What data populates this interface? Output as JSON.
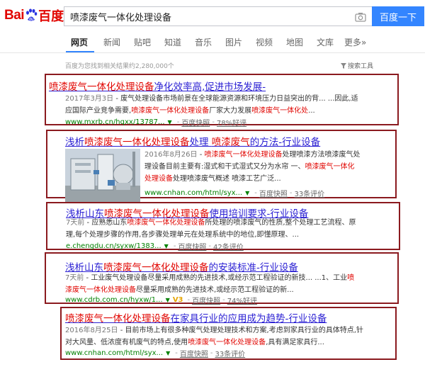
{
  "logo": {
    "bai": "Bai",
    "du": "百度"
  },
  "search": {
    "query": "喷漆废气一体化处理设备",
    "button": "百度一下"
  },
  "nav": {
    "tabs": [
      "网页",
      "新闻",
      "贴吧",
      "知道",
      "音乐",
      "图片",
      "视频",
      "地图",
      "文库",
      "更多»"
    ]
  },
  "result_stats": "百度为您找到相关结果约2,280,000个",
  "search_tools": "搜索工具",
  "results": [
    {
      "title_parts": [
        "喷漆废气一体化处理设备",
        "净化效率高,促进市场发展-"
      ],
      "abstract": {
        "line1": [
          "2017年3月3日",
          " - 废气处理设备市场前景在全球能源资源和环境压力日益突出的背... ...因此,适"
        ],
        "line2": [
          "应国际产业竞争需要,",
          "喷漆废气一体化处理设备",
          "厂家大力发展",
          "喷漆废气一体化处",
          "..."
        ]
      },
      "url": "www.mxrb.cn/hqxx/13787...",
      "cache": "百度快照",
      "rating": "78%好评"
    },
    {
      "title_parts": [
        "浅析",
        "喷漆废气一体化处理设备",
        "处理 ",
        "喷漆废气",
        "的方法-行业设备"
      ],
      "abstract": {
        "line1": [
          "2016年8月26日",
          " - ",
          "喷漆废气一体化处理设备",
          "处理喷漆方法喷漆废气处"
        ],
        "line2": [
          "理设备目前主要有:湿式和干式湿式又分为水帘 一、",
          "喷漆废气一体化"
        ],
        "line3": [
          "处理设备",
          "处理喷漆废气概述 喷漆工艺广泛..."
        ]
      },
      "url": "www.cnhan.com/html/syx...",
      "cache": "百度快照",
      "rating": "33条评价"
    },
    {
      "title_parts": [
        "浅析山东",
        "喷漆废气一体化处理设备",
        "使用培训要求-行业设备"
      ],
      "abstract": {
        "line1": [
          "7天前",
          " - 应熟悉山东",
          "喷漆废气一体化处理设备",
          "所处理的喷漆废气的性质,整个处理工艺流程、原"
        ],
        "line2": [
          "理,每个处理步骤的作用,各步骤处理单元在处理系统中的地位,即懂原理、..."
        ]
      },
      "url": "e.chengdu.cn/syxw/1383...",
      "cache": "百度快照",
      "rating": "42条评价"
    },
    {
      "title_parts": [
        "浅析山东",
        "喷漆废气一体化处理设备",
        "的安装标准-行业设备"
      ],
      "abstract": {
        "line1": [
          "7天前",
          " - 工业废气处理设备尽量采用成熟的先进技术,或经示范工程验证的新技... ...1、工业",
          "喷"
        ],
        "line2": [
          "漆废气一体化处理设备",
          "尽量采用成熟的先进技术,或经示范工程验证的新..."
        ]
      },
      "url": "www.cdrb.com.cn/hyxw/1...",
      "v3": "V3",
      "cache": "百度快照",
      "rating": "74%好评"
    },
    {
      "title_parts": [
        "喷漆废气一体化处理设备",
        "在家具行业的应用成为趋势-行业设备"
      ],
      "abstract": {
        "line1": [
          "2016年8月25日",
          " - 目前市场上有很多种废气处理处理技术和方案,考虑到家具行业的具体特点,针"
        ],
        "line2": [
          "对大风量、低浓度有机废气的特点,使用",
          "喷漆废气一体化处理设备",
          ",具有满足家具行..."
        ]
      },
      "url": "www.cnhan.com/html/syx...",
      "cache": "百度快照",
      "rating": "33条评价"
    }
  ],
  "colors": {
    "accent": "#3385ff",
    "title": "#2a1fd3",
    "highlight": "#e10602",
    "url": "#008000",
    "box_border": "#8b1a1f"
  }
}
